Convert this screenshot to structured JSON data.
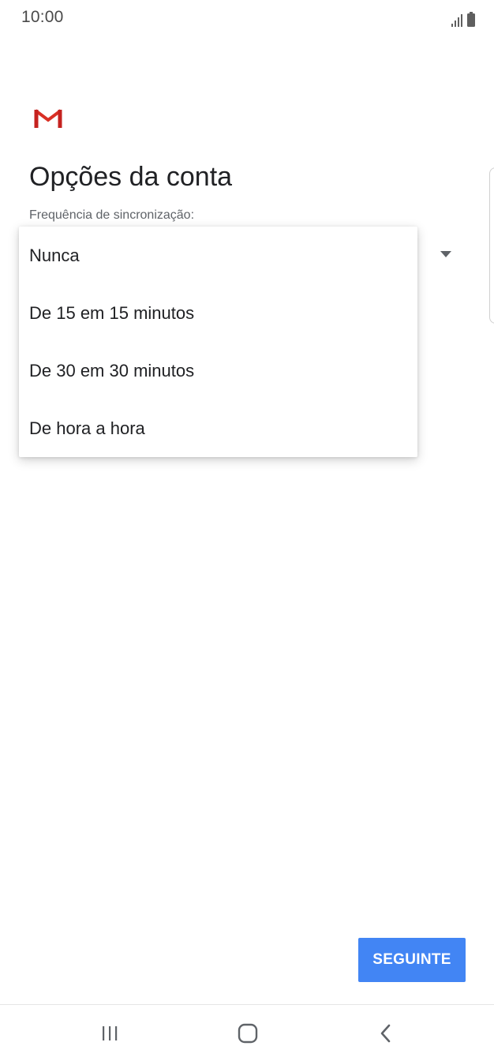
{
  "status_bar": {
    "time": "10:00",
    "icons": [
      "signal-icon",
      "battery-icon"
    ]
  },
  "app": {
    "logo_icon": "gmail-logo-icon",
    "brand_color": "#d93025"
  },
  "page": {
    "title": "Opções da conta",
    "field_label": "Frequência de sincronização:"
  },
  "dropdown": {
    "options": [
      {
        "label": "Nunca"
      },
      {
        "label": "De 15 em 15 minutos"
      },
      {
        "label": "De 30 em 30 minutos"
      },
      {
        "label": "De hora a hora"
      }
    ]
  },
  "actions": {
    "next_label": "SEGUINTE",
    "next_color": "#4285f4"
  },
  "nav": {
    "icons": [
      "recent-apps-icon",
      "home-icon",
      "back-icon"
    ]
  }
}
